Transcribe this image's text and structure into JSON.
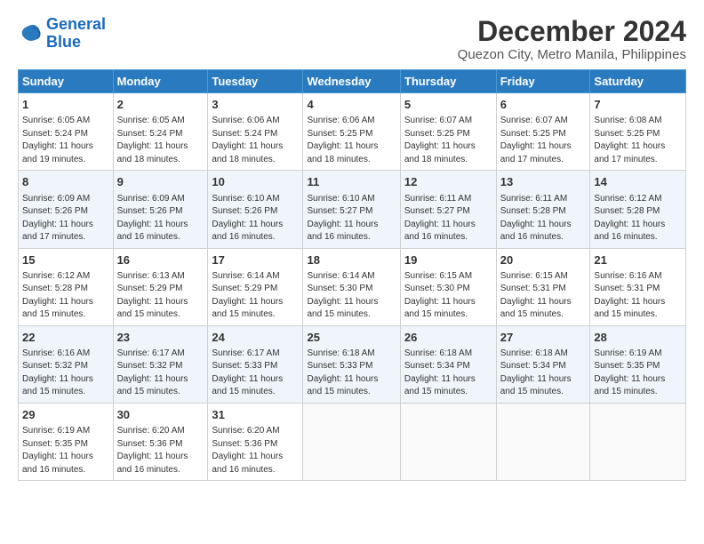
{
  "logo": {
    "line1": "General",
    "line2": "Blue"
  },
  "title": "December 2024",
  "subtitle": "Quezon City, Metro Manila, Philippines",
  "days_of_week": [
    "Sunday",
    "Monday",
    "Tuesday",
    "Wednesday",
    "Thursday",
    "Friday",
    "Saturday"
  ],
  "weeks": [
    [
      {
        "day": "1",
        "info": "Sunrise: 6:05 AM\nSunset: 5:24 PM\nDaylight: 11 hours\nand 19 minutes."
      },
      {
        "day": "2",
        "info": "Sunrise: 6:05 AM\nSunset: 5:24 PM\nDaylight: 11 hours\nand 18 minutes."
      },
      {
        "day": "3",
        "info": "Sunrise: 6:06 AM\nSunset: 5:24 PM\nDaylight: 11 hours\nand 18 minutes."
      },
      {
        "day": "4",
        "info": "Sunrise: 6:06 AM\nSunset: 5:25 PM\nDaylight: 11 hours\nand 18 minutes."
      },
      {
        "day": "5",
        "info": "Sunrise: 6:07 AM\nSunset: 5:25 PM\nDaylight: 11 hours\nand 18 minutes."
      },
      {
        "day": "6",
        "info": "Sunrise: 6:07 AM\nSunset: 5:25 PM\nDaylight: 11 hours\nand 17 minutes."
      },
      {
        "day": "7",
        "info": "Sunrise: 6:08 AM\nSunset: 5:25 PM\nDaylight: 11 hours\nand 17 minutes."
      }
    ],
    [
      {
        "day": "8",
        "info": "Sunrise: 6:09 AM\nSunset: 5:26 PM\nDaylight: 11 hours\nand 17 minutes."
      },
      {
        "day": "9",
        "info": "Sunrise: 6:09 AM\nSunset: 5:26 PM\nDaylight: 11 hours\nand 16 minutes."
      },
      {
        "day": "10",
        "info": "Sunrise: 6:10 AM\nSunset: 5:26 PM\nDaylight: 11 hours\nand 16 minutes."
      },
      {
        "day": "11",
        "info": "Sunrise: 6:10 AM\nSunset: 5:27 PM\nDaylight: 11 hours\nand 16 minutes."
      },
      {
        "day": "12",
        "info": "Sunrise: 6:11 AM\nSunset: 5:27 PM\nDaylight: 11 hours\nand 16 minutes."
      },
      {
        "day": "13",
        "info": "Sunrise: 6:11 AM\nSunset: 5:28 PM\nDaylight: 11 hours\nand 16 minutes."
      },
      {
        "day": "14",
        "info": "Sunrise: 6:12 AM\nSunset: 5:28 PM\nDaylight: 11 hours\nand 16 minutes."
      }
    ],
    [
      {
        "day": "15",
        "info": "Sunrise: 6:12 AM\nSunset: 5:28 PM\nDaylight: 11 hours\nand 15 minutes."
      },
      {
        "day": "16",
        "info": "Sunrise: 6:13 AM\nSunset: 5:29 PM\nDaylight: 11 hours\nand 15 minutes."
      },
      {
        "day": "17",
        "info": "Sunrise: 6:14 AM\nSunset: 5:29 PM\nDaylight: 11 hours\nand 15 minutes."
      },
      {
        "day": "18",
        "info": "Sunrise: 6:14 AM\nSunset: 5:30 PM\nDaylight: 11 hours\nand 15 minutes."
      },
      {
        "day": "19",
        "info": "Sunrise: 6:15 AM\nSunset: 5:30 PM\nDaylight: 11 hours\nand 15 minutes."
      },
      {
        "day": "20",
        "info": "Sunrise: 6:15 AM\nSunset: 5:31 PM\nDaylight: 11 hours\nand 15 minutes."
      },
      {
        "day": "21",
        "info": "Sunrise: 6:16 AM\nSunset: 5:31 PM\nDaylight: 11 hours\nand 15 minutes."
      }
    ],
    [
      {
        "day": "22",
        "info": "Sunrise: 6:16 AM\nSunset: 5:32 PM\nDaylight: 11 hours\nand 15 minutes."
      },
      {
        "day": "23",
        "info": "Sunrise: 6:17 AM\nSunset: 5:32 PM\nDaylight: 11 hours\nand 15 minutes."
      },
      {
        "day": "24",
        "info": "Sunrise: 6:17 AM\nSunset: 5:33 PM\nDaylight: 11 hours\nand 15 minutes."
      },
      {
        "day": "25",
        "info": "Sunrise: 6:18 AM\nSunset: 5:33 PM\nDaylight: 11 hours\nand 15 minutes."
      },
      {
        "day": "26",
        "info": "Sunrise: 6:18 AM\nSunset: 5:34 PM\nDaylight: 11 hours\nand 15 minutes."
      },
      {
        "day": "27",
        "info": "Sunrise: 6:18 AM\nSunset: 5:34 PM\nDaylight: 11 hours\nand 15 minutes."
      },
      {
        "day": "28",
        "info": "Sunrise: 6:19 AM\nSunset: 5:35 PM\nDaylight: 11 hours\nand 15 minutes."
      }
    ],
    [
      {
        "day": "29",
        "info": "Sunrise: 6:19 AM\nSunset: 5:35 PM\nDaylight: 11 hours\nand 16 minutes."
      },
      {
        "day": "30",
        "info": "Sunrise: 6:20 AM\nSunset: 5:36 PM\nDaylight: 11 hours\nand 16 minutes."
      },
      {
        "day": "31",
        "info": "Sunrise: 6:20 AM\nSunset: 5:36 PM\nDaylight: 11 hours\nand 16 minutes."
      },
      {
        "day": "",
        "info": ""
      },
      {
        "day": "",
        "info": ""
      },
      {
        "day": "",
        "info": ""
      },
      {
        "day": "",
        "info": ""
      }
    ]
  ]
}
